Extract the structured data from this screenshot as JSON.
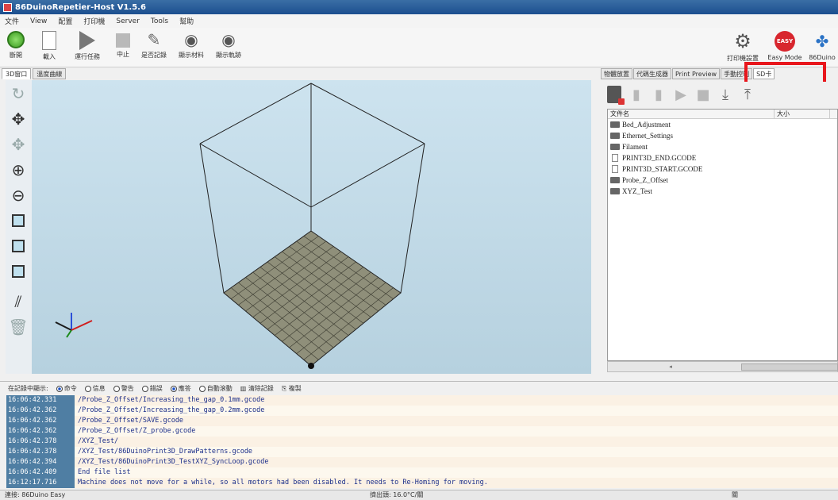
{
  "window": {
    "title": "86DuinoRepetier-Host V1.5.6"
  },
  "menu": [
    "文件",
    "View",
    "配置",
    "打印機",
    "Server",
    "Tools",
    "幫助"
  ],
  "toolbar": {
    "connect": "斷開",
    "load": "載入",
    "run": "運行任務",
    "stop": "中止",
    "edit": "是否記錄",
    "show_filament": "顯示材料",
    "show_path": "顯示軌跡",
    "printer_settings": "打印機設置",
    "easy_mode": "Easy Mode",
    "duino": "86Duino"
  },
  "view_tabs": [
    "3D窗口",
    "溫度曲線"
  ],
  "right_tabs": [
    "物體放置",
    "代碼生成器",
    "Print Preview",
    "手動控制",
    "SD卡"
  ],
  "file_list": {
    "columns": [
      "文件名",
      "大小"
    ],
    "items": [
      {
        "name": "Bed_Adjustment",
        "type": "folder"
      },
      {
        "name": "Ethernet_Settings",
        "type": "folder"
      },
      {
        "name": "Filament",
        "type": "folder"
      },
      {
        "name": "PRINT3D_END.GCODE",
        "type": "file"
      },
      {
        "name": "PRINT3D_START.GCODE",
        "type": "file"
      },
      {
        "name": "Probe_Z_Offset",
        "type": "folder"
      },
      {
        "name": "XYZ_Test",
        "type": "folder"
      }
    ]
  },
  "log_options": {
    "label": "在記錄中顯示:",
    "items": [
      "命令",
      "信息",
      "警告",
      "錯誤",
      "應答",
      "自動滾動"
    ],
    "checked": [
      true,
      false,
      false,
      false,
      true,
      false
    ],
    "clear": "清除記錄",
    "copy": "複製"
  },
  "log": [
    {
      "time": "16:06:42.331",
      "text": "/Probe_Z_Offset/Increasing_the_gap_0.1mm.gcode"
    },
    {
      "time": "16:06:42.362",
      "text": "/Probe_Z_Offset/Increasing_the_gap_0.2mm.gcode"
    },
    {
      "time": "16:06:42.362",
      "text": "/Probe_Z_Offset/SAVE.gcode"
    },
    {
      "time": "16:06:42.362",
      "text": "/Probe_Z_Offset/Z_probe.gcode"
    },
    {
      "time": "16:06:42.378",
      "text": "/XYZ_Test/"
    },
    {
      "time": "16:06:42.378",
      "text": "/XYZ_Test/86DuinoPrint3D_DrawPatterns.gcode"
    },
    {
      "time": "16:06:42.394",
      "text": "/XYZ_Test/86DuinoPrint3D_TestXYZ_SyncLoop.gcode"
    },
    {
      "time": "16:06:42.409",
      "text": "End file list"
    },
    {
      "time": "16:12:17.716",
      "text": "Machine does not move for a while, so all motors had been disabled. It needs to Re-Homing for moving."
    }
  ],
  "status": {
    "connection": "連接: 86Duino Easy",
    "extruder": "擠出頭: 16.0°C/關",
    "bed": "關"
  },
  "colors": {
    "highlight": "#e8161c",
    "log_ts_bg": "#4f7ea3",
    "bed_grid": "#8f8f7a"
  }
}
